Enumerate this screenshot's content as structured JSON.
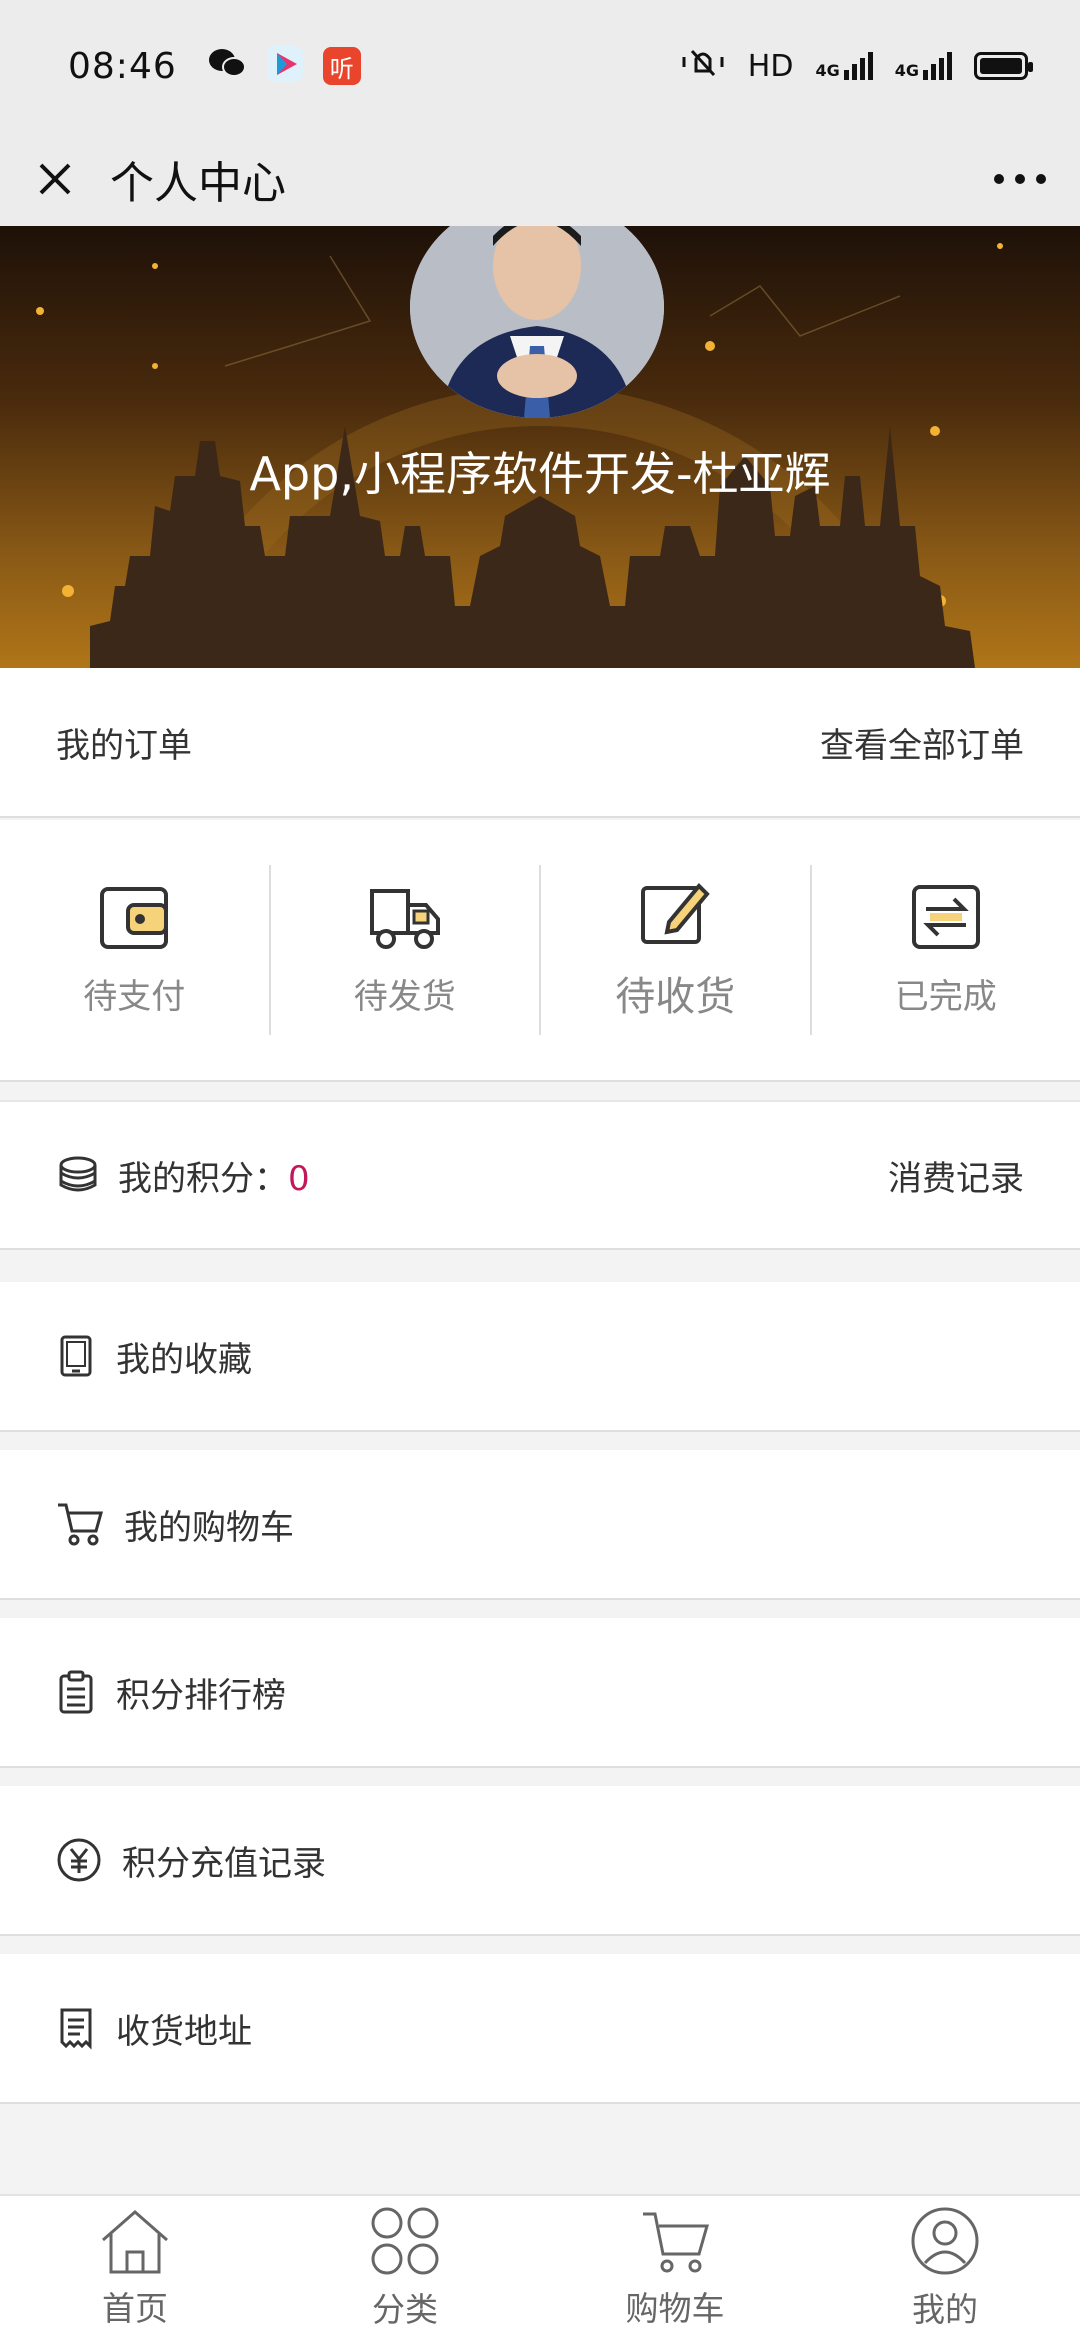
{
  "status_bar": {
    "time": "08:46",
    "apps": [
      {
        "name": "wechat-icon",
        "glyph": "",
        "color": "#111111"
      },
      {
        "name": "video-app-icon",
        "glyph": "",
        "color": "#1e9bd7"
      },
      {
        "name": "ting-app-icon",
        "glyph": "听",
        "color": "#e8452c"
      }
    ],
    "network": "HD",
    "signal_labels": [
      "4G",
      "4G"
    ]
  },
  "nav": {
    "title": "个人中心"
  },
  "profile": {
    "name": "App,小程序软件开发-杜亚辉"
  },
  "orders": {
    "title": "我的订单",
    "view_all": "查看全部订单",
    "items": [
      {
        "label": "待支付",
        "icon": "wallet-icon"
      },
      {
        "label": "待发货",
        "icon": "delivery-truck-icon"
      },
      {
        "label": "待收货",
        "icon": "edit-icon"
      },
      {
        "label": "已完成",
        "icon": "exchange-icon"
      }
    ]
  },
  "points": {
    "label": "我的积分：",
    "value": "0",
    "record": "消费记录"
  },
  "menu": [
    {
      "label": "我的收藏",
      "icon": "favorites-icon"
    },
    {
      "label": "我的购物车",
      "icon": "cart-icon"
    },
    {
      "label": "积分排行榜",
      "icon": "clipboard-icon"
    },
    {
      "label": "积分充值记录",
      "icon": "yuan-icon"
    },
    {
      "label": "收货地址",
      "icon": "address-icon"
    }
  ],
  "tabbar": [
    {
      "label": "首页",
      "icon": "home-icon"
    },
    {
      "label": "分类",
      "icon": "category-icon"
    },
    {
      "label": "购物车",
      "icon": "cart-icon"
    },
    {
      "label": "我的",
      "icon": "user-icon"
    }
  ],
  "colors": {
    "accent": "#c2185b",
    "hero_top": "#1e1108",
    "hero_bottom": "#b07518"
  }
}
